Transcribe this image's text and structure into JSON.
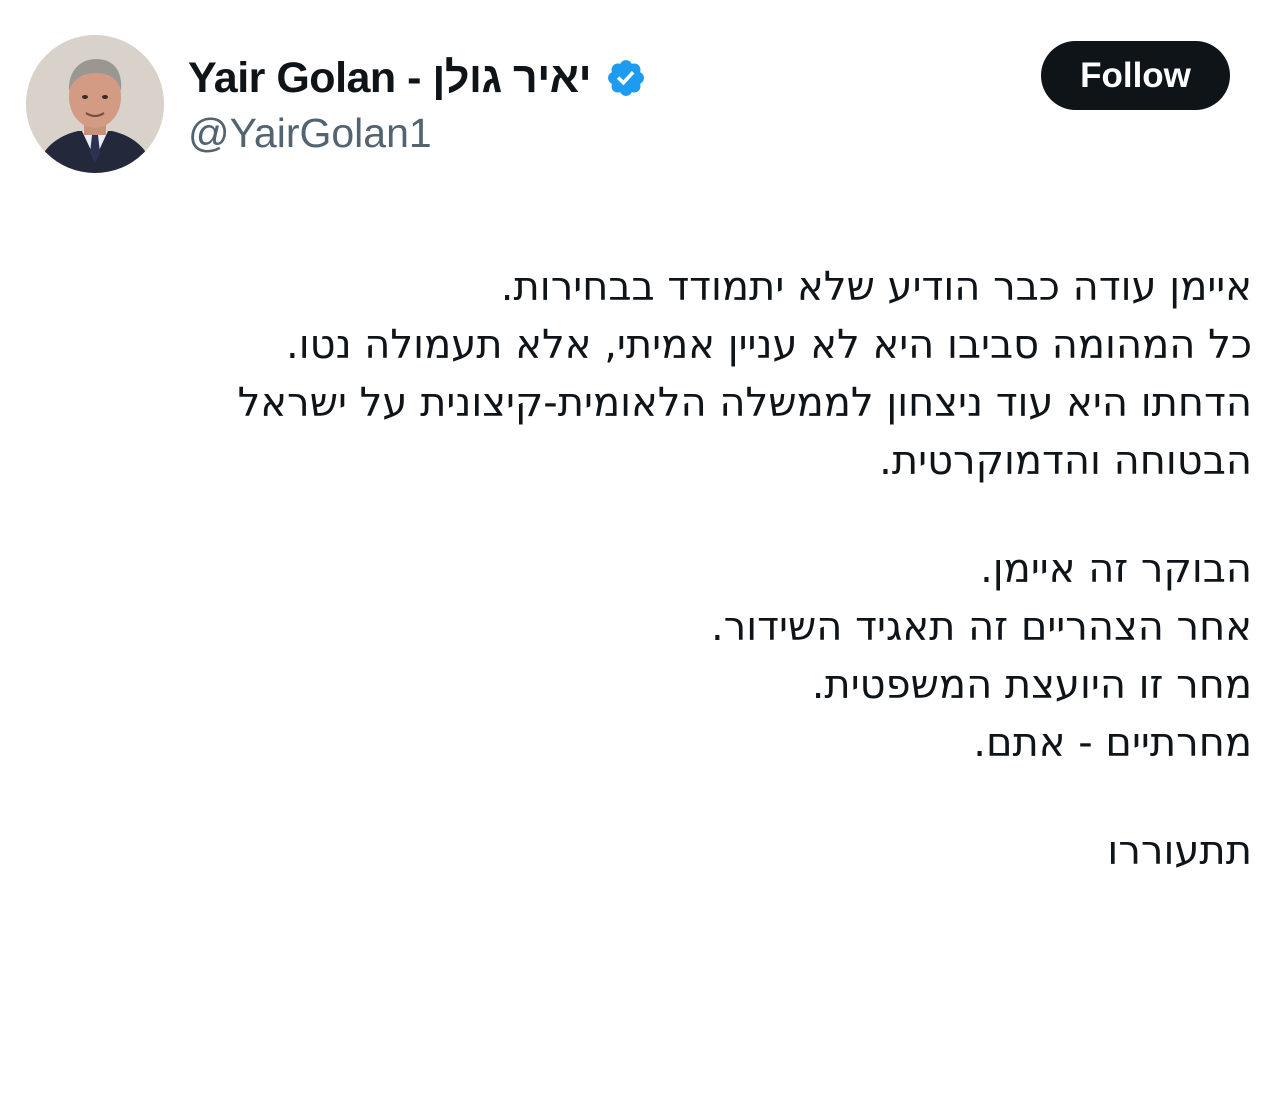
{
  "profile": {
    "display_name": "Yair Golan - יאיר גולן",
    "handle": "@YairGolan1",
    "verified_icon": "verified-badge-icon",
    "avatar_icon": "profile-photo"
  },
  "follow_button": {
    "label": "Follow"
  },
  "tweet": {
    "paragraph1": [
      "איימן עודה כבר הודיע שלא יתמודד בבחירות.",
      "כל המהומה סביבו היא לא עניין אמיתי, אלא תעמולה נטו.",
      "הדחתו היא עוד ניצחון לממשלה הלאומית-קיצונית על ישראל",
      "הבטוחה והדמוקרטית."
    ],
    "paragraph2": [
      "הבוקר זה איימן.",
      "אחר הצהריים זה תאגיד השידור.",
      "מחר זו היועצת המשפטית.",
      "מחרתיים - אתם."
    ],
    "closing": "תתעוררו"
  },
  "colors": {
    "text": "#0f1419",
    "secondary_text": "#536471",
    "verified_blue": "#1d9bf0",
    "button_bg": "#0f1419",
    "button_text": "#ffffff",
    "background": "#ffffff"
  }
}
